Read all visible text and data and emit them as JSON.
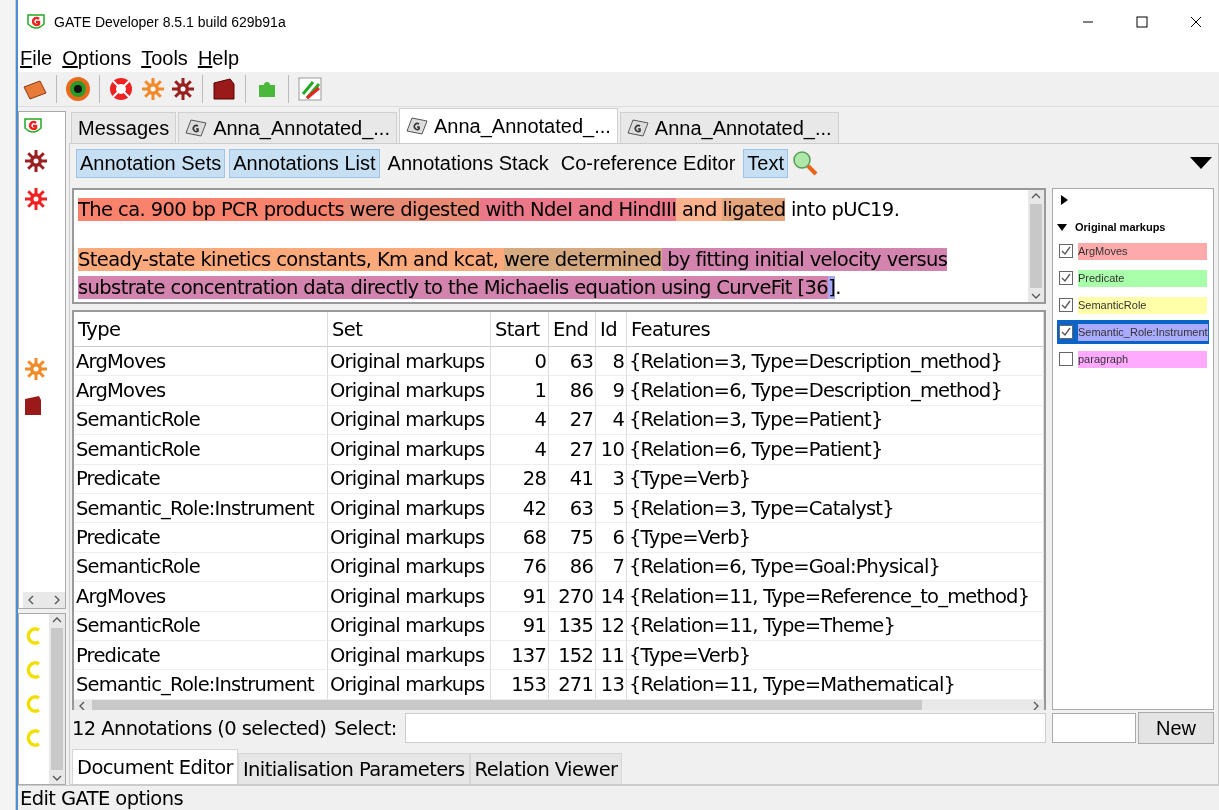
{
  "window": {
    "title": "GATE Developer 8.5.1 build 629b91a"
  },
  "menu": [
    "File",
    "Options",
    "Tools",
    "Help"
  ],
  "document_tabs": [
    {
      "label": "Messages",
      "kind": "plain",
      "selected": false
    },
    {
      "label": "Anna_Annotated_...",
      "kind": "document",
      "selected": false
    },
    {
      "label": "Anna_Annotated_...",
      "kind": "document",
      "selected": true
    },
    {
      "label": "Anna_Annotated_...",
      "kind": "document",
      "selected": false
    }
  ],
  "view_toggles": [
    {
      "label": "Annotation Sets",
      "selected": true
    },
    {
      "label": "Annotations List",
      "selected": true
    },
    {
      "label": "Annotations Stack",
      "selected": false
    },
    {
      "label": "Co-reference Editor",
      "selected": false
    },
    {
      "label": "Text",
      "selected": true
    }
  ],
  "document_text": [
    [
      {
        "text": "The ca. 900 bp PCR products",
        "color": "#f8826c"
      },
      {
        "text": " were digested",
        "color": "#e88a74"
      },
      {
        "text": " with NdeI and HindIII",
        "color": "#ea7888"
      },
      {
        "text": " and ",
        "color": "#fcb08c"
      },
      {
        "text": "ligated",
        "color": "#e4a47c"
      },
      {
        "text": " into pUC19.",
        "color": "#ffffff"
      }
    ],
    [
      {
        "text": "Steady-state kinetics constants, Km and kcat, ",
        "color": "#fca97c"
      },
      {
        "text": "were determined",
        "color": "#d6aa80"
      },
      {
        "text": " by fitting initial velocity versus substrate concentration data directly to the Michaelis equation using CurveFit [36",
        "color": "#d284ae"
      },
      {
        "text": "]",
        "color": "#a8a8f4"
      },
      {
        "text": ".",
        "color": "#ffffff"
      }
    ]
  ],
  "annotation_sets": {
    "set_name": "Original markups",
    "types": [
      {
        "label": "ArgMoves",
        "checked": true,
        "selected": false,
        "color": "#ffaaaa"
      },
      {
        "label": "Predicate",
        "checked": true,
        "selected": false,
        "color": "#aaffaa"
      },
      {
        "label": "SemanticRole",
        "checked": true,
        "selected": false,
        "color": "#ffffaa"
      },
      {
        "label": "Semantic_Role:Instrument",
        "checked": true,
        "selected": true,
        "color": "#aaaaff"
      },
      {
        "label": "paragraph",
        "checked": false,
        "selected": false,
        "color": "#ffaaff"
      }
    ],
    "new_button": "New"
  },
  "table": {
    "columns": [
      "Type",
      "Set",
      "Start",
      "End",
      "Id",
      "Features"
    ],
    "rows": [
      [
        "ArgMoves",
        "Original markups",
        "0",
        "63",
        "8",
        "{Relation=3, Type=Description_method}"
      ],
      [
        "ArgMoves",
        "Original markups",
        "1",
        "86",
        "9",
        "{Relation=6, Type=Description_method}"
      ],
      [
        "SemanticRole",
        "Original markups",
        "4",
        "27",
        "4",
        "{Relation=3, Type=Patient}"
      ],
      [
        "SemanticRole",
        "Original markups",
        "4",
        "27",
        "10",
        "{Relation=6, Type=Patient}"
      ],
      [
        "Predicate",
        "Original markups",
        "28",
        "41",
        "3",
        "{Type=Verb}"
      ],
      [
        "Semantic_Role:Instrument",
        "Original markups",
        "42",
        "63",
        "5",
        "{Relation=3, Type=Catalyst}"
      ],
      [
        "Predicate",
        "Original markups",
        "68",
        "75",
        "6",
        "{Type=Verb}"
      ],
      [
        "SemanticRole",
        "Original markups",
        "76",
        "86",
        "7",
        "{Relation=6, Type=Goal:Physical}"
      ],
      [
        "ArgMoves",
        "Original markups",
        "91",
        "270",
        "14",
        "{Relation=11, Type=Reference_to_method}"
      ],
      [
        "SemanticRole",
        "Original markups",
        "91",
        "135",
        "12",
        "{Relation=11, Type=Theme}"
      ],
      [
        "Predicate",
        "Original markups",
        "137",
        "152",
        "11",
        "{Type=Verb}"
      ],
      [
        "Semantic_Role:Instrument",
        "Original markups",
        "153",
        "271",
        "13",
        "{Relation=11, Type=Mathematical}"
      ]
    ]
  },
  "annotation_count": "12 Annotations (0 selected)",
  "select_label": "Select:",
  "bottom_tabs": [
    {
      "label": "Document Editor",
      "selected": true
    },
    {
      "label": "Initialisation Parameters",
      "selected": false
    },
    {
      "label": "Relation Viewer",
      "selected": false
    }
  ],
  "status_bar": "Edit GATE options"
}
